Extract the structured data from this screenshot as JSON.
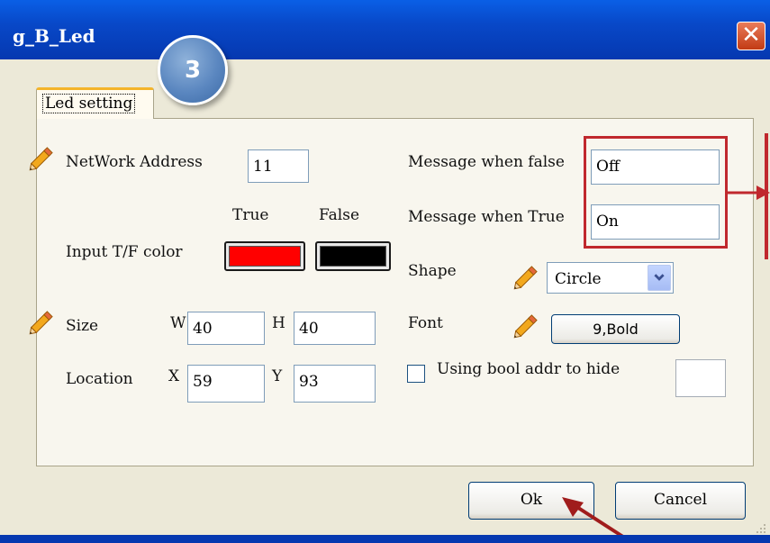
{
  "window": {
    "title": "g_B_Led",
    "close_glyph": "✕"
  },
  "step_badge": "3",
  "tab": {
    "label": "Led setting"
  },
  "network": {
    "label": "NetWork Address",
    "value": "11"
  },
  "color": {
    "true_label": "True",
    "false_label": "False",
    "input_label": "Input T/F color",
    "true_color": "#ff0000",
    "false_color": "#000000"
  },
  "size": {
    "label": "Size",
    "w_label": "W",
    "w_value": "40",
    "h_label": "H",
    "h_value": "40"
  },
  "location": {
    "label": "Location",
    "x_label": "X",
    "x_value": "59",
    "y_label": "Y",
    "y_value": "93"
  },
  "message": {
    "false_label": "Message when false",
    "false_value": "Off",
    "true_label": "Message when True",
    "true_value": "On"
  },
  "shape": {
    "label": "Shape",
    "value": "Circle"
  },
  "font": {
    "label": "Font",
    "value": "9,Bold"
  },
  "hide": {
    "label": "Using bool addr to hide",
    "checked": false
  },
  "buttons": {
    "ok": "Ok",
    "cancel": "Cancel"
  },
  "icons": {
    "pencil": "pencil-icon",
    "dropdown": "chevron-down-icon",
    "close": "close-icon"
  },
  "accent": {
    "annotation": "#c0282d",
    "titlebar": "#0848c8"
  }
}
